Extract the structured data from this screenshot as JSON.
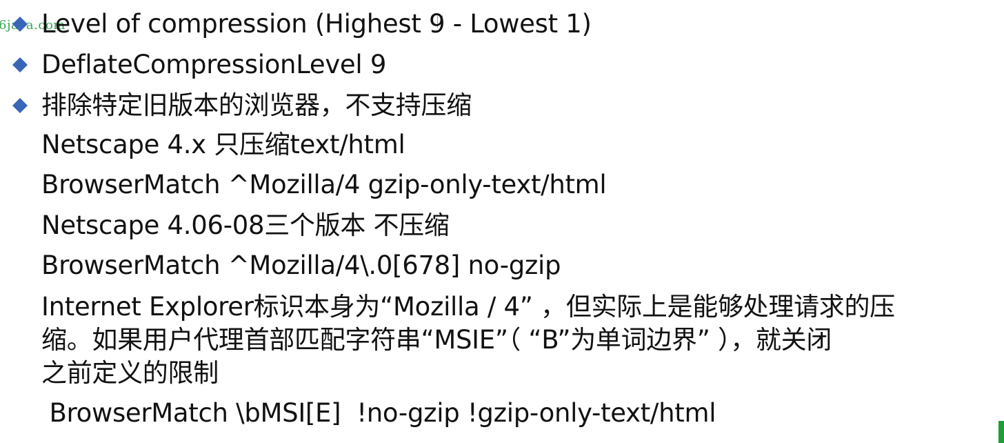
{
  "watermark": "6java.com",
  "slide": {
    "bullets": [
      {
        "text": "Level of compression (Highest 9 - Lowest 1)"
      },
      {
        "text": "DeflateCompressionLevel 9"
      },
      {
        "text": "排除特定旧版本的浏览器，不支持压缩"
      }
    ],
    "lines": [
      "Netscape 4.x 只压缩text/html",
      "BrowserMatch ^Mozilla/4  gzip-only-text/html",
      "Netscape 4.06-08三个版本 不压缩",
      "BrowserMatch  ^Mozilla/4\\.0[678]  no-gzip"
    ],
    "paragraph": [
      "Internet Explorer标识本身为“Mozilla / 4” ，但实际上是能够处理请求的压",
      "缩。如果用户代理首部匹配字符串“MSIE”（ “B”为单词边界” ），就关闭",
      "之前定义的限制"
    ],
    "last_line": " BrowserMatch \\bMSI[E]  !no-gzip !gzip-only-text/html"
  },
  "colors": {
    "bullet": "#3a66b8",
    "watermark": "#2e9e4a",
    "text": "#111111"
  }
}
